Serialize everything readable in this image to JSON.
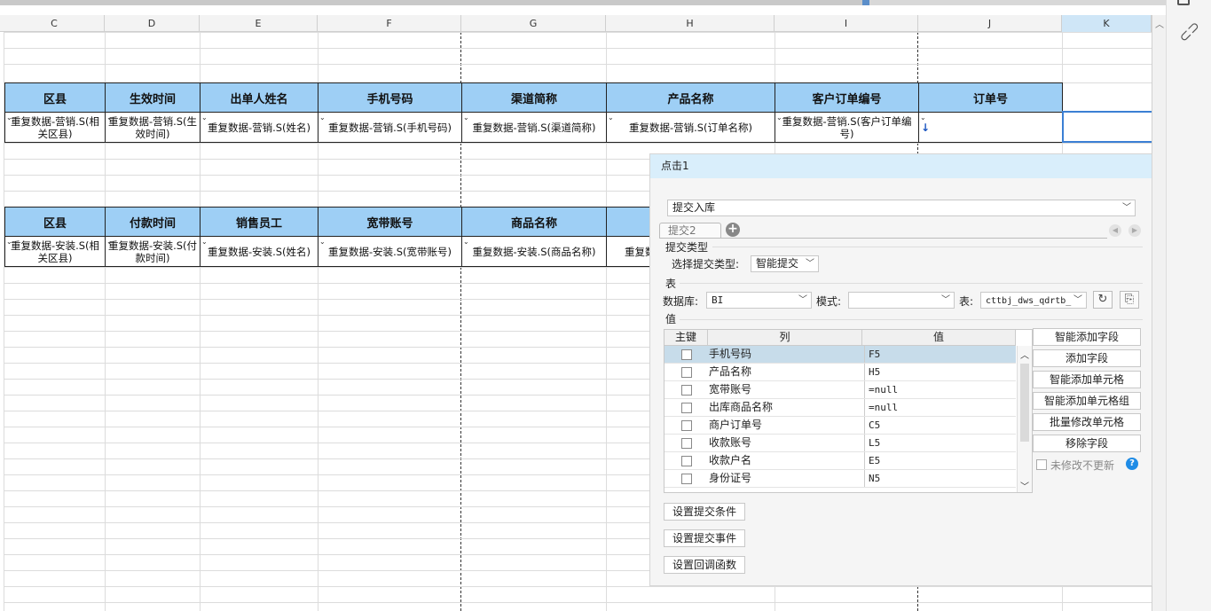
{
  "sheet": {
    "columns": [
      "C",
      "D",
      "E",
      "F",
      "G",
      "H",
      "I",
      "J",
      "K"
    ],
    "selected_column": "K",
    "table1": {
      "headers": [
        "区县",
        "生效时间",
        "出单人姓名",
        "手机号码",
        "渠道简称",
        "产品名称",
        "客户订单编号",
        "订单号"
      ],
      "cells": [
        "重复数据-营销.S(相关区县)",
        "重复数据-营销.S(生效时间)",
        "重复数据-营销.S(姓名)",
        "重复数据-营销.S(手机号码)",
        "重复数据-营销.S(渠道简称)",
        "重复数据-营销.S(订单名称)",
        "重复数据-营销.S(客户订单编号)",
        ""
      ]
    },
    "table2": {
      "headers": [
        "区县",
        "付款时间",
        "销售员工",
        "宽带账号",
        "商品名称"
      ],
      "cells": [
        "重复数据-安装.S(相关区县)",
        "重复数据-安装.S(付款时间)",
        "重复数据-安装.S(姓名)",
        "重复数据-安装.S(宽带账号)",
        "重复数据-安装.S(商品名称)",
        "重复数"
      ]
    }
  },
  "panel": {
    "title": "点击1",
    "action_select": "提交入库",
    "tab_label": "提交2",
    "submit_type_section": "提交类型",
    "submit_type_label": "选择提交类型:",
    "submit_type_value": "智能提交",
    "table_section": "表",
    "database_label": "数据库:",
    "database_value": "BI",
    "schema_label": "模式:",
    "schema_value": "",
    "table_label": "表:",
    "table_value": "cttbj_dws_qdrtb_",
    "values_section": "值",
    "grid_headers": {
      "key": "主键",
      "column": "列",
      "value": "值"
    },
    "rows": [
      {
        "column": "手机号码",
        "value": "F5"
      },
      {
        "column": "产品名称",
        "value": "H5"
      },
      {
        "column": "宽带账号",
        "value": "=null"
      },
      {
        "column": "出库商品名称",
        "value": "=null"
      },
      {
        "column": "商户订单号",
        "value": "C5"
      },
      {
        "column": "收款账号",
        "value": "L5"
      },
      {
        "column": "收款户名",
        "value": "E5"
      },
      {
        "column": "身份证号",
        "value": "N5"
      }
    ],
    "side_buttons": [
      "智能添加字段",
      "添加字段",
      "智能添加单元格",
      "智能添加单元格组",
      "批量修改单元格",
      "移除字段"
    ],
    "no_update_label": "未修改不更新",
    "bottom_buttons": [
      "设置提交条件",
      "设置提交事件",
      "设置回调函数"
    ],
    "colors": {
      "header_fill": "#9ecff5",
      "title_bar": "#d9eefb",
      "selected_row": "#c7dcea",
      "help_icon": "#1f8ce6"
    }
  }
}
